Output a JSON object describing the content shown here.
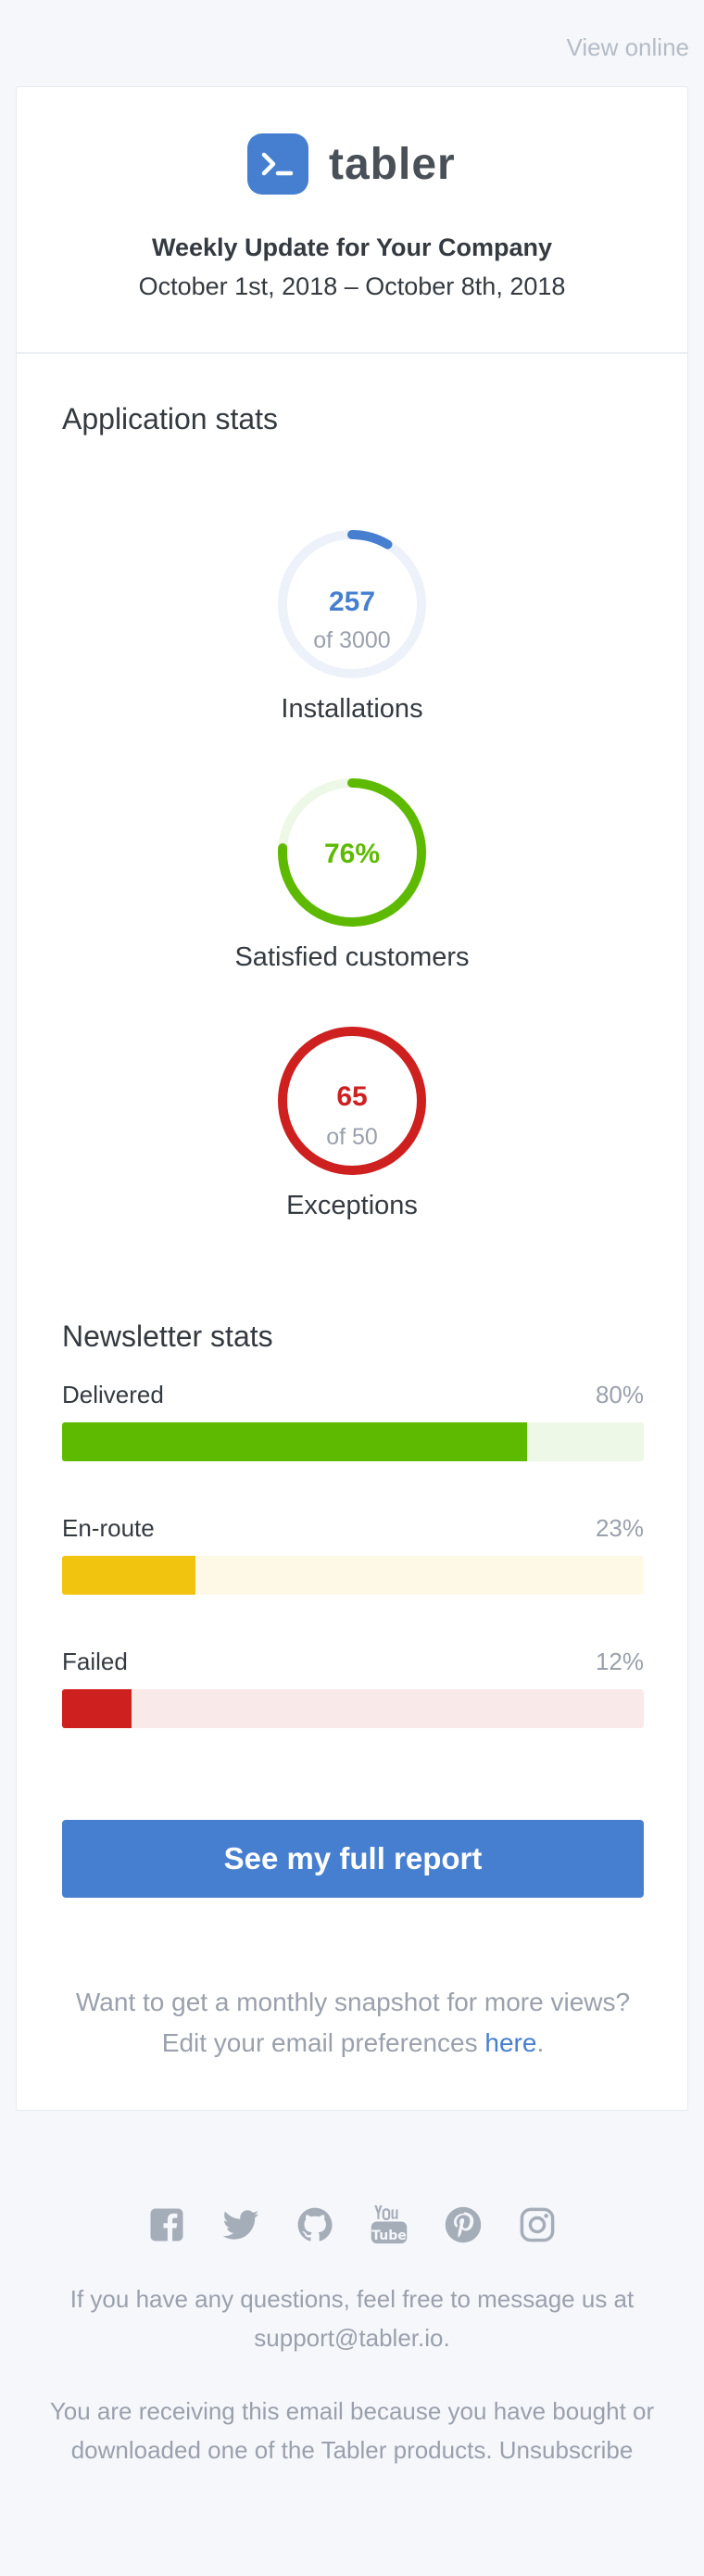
{
  "header": {
    "view_online": "View online",
    "brand": "tabler",
    "subject": "Weekly Update for Your Company",
    "date_range": "October 1st, 2018 – October 8th, 2018"
  },
  "app_stats": {
    "title": "Application stats",
    "items": [
      {
        "value": "257",
        "sub": "of 3000",
        "label": "Installations",
        "fraction": 0.0857,
        "color": "#467fcf",
        "track": "#edf2fa"
      },
      {
        "value": "76%",
        "sub": "",
        "label": "Satisfied customers",
        "fraction": 0.76,
        "color": "#5eba00",
        "track": "#eef8e6"
      },
      {
        "value": "65",
        "sub": "of 50",
        "label": "Exceptions",
        "fraction": 1.0,
        "color": "#cd201f",
        "track": "#fae9e9"
      }
    ]
  },
  "newsletter": {
    "title": "Newsletter stats",
    "items": [
      {
        "label": "Delivered",
        "percent_label": "80%",
        "percent": 80,
        "color": "#5eba00",
        "track": "#eef8e6"
      },
      {
        "label": "En-route",
        "percent_label": "23%",
        "percent": 23,
        "color": "#f1c40f",
        "track": "#fef9e7"
      },
      {
        "label": "Failed",
        "percent_label": "12%",
        "percent": 12,
        "color": "#cd201f",
        "track": "#fae9e9"
      }
    ]
  },
  "cta": {
    "label": "See my full report"
  },
  "prefs": {
    "text": "Want to get a monthly snapshot for more views? Edit your email preferences ",
    "link": "here",
    "end": "."
  },
  "footer": {
    "social": [
      "facebook-icon",
      "twitter-icon",
      "github-icon",
      "youtube-icon",
      "pinterest-icon",
      "instagram-icon"
    ],
    "contact_text": "If you have any questions, feel free to message us at ",
    "contact_email": "support@tabler.io",
    "contact_end": ".",
    "reason_text": "You are receiving this email because you have bought or downloaded one of the Tabler products. ",
    "unsubscribe": "Unsubscribe"
  }
}
